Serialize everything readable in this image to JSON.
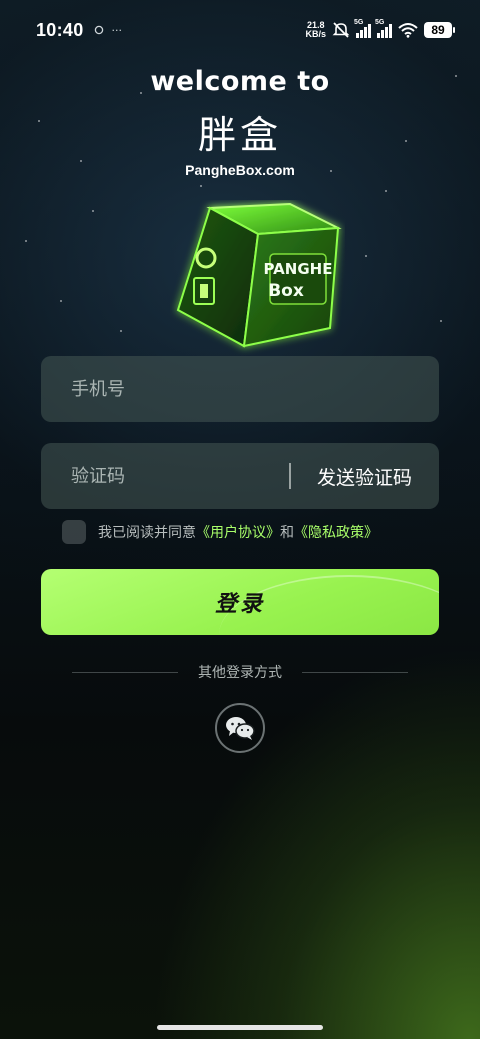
{
  "status_bar": {
    "time": "10:40",
    "notification_icons": [
      "message-icon",
      "more-icon"
    ],
    "net_speed_value": "21.8",
    "net_speed_unit": "KB/s",
    "sim1_label": "5G",
    "sim2_label": "5G",
    "battery": "89"
  },
  "brand": {
    "welcome": "welcome to",
    "logo_text": "胖盒",
    "domain": "PangheBox.com",
    "cube_text_line1": "PANGHE",
    "cube_text_line2": "Box"
  },
  "form": {
    "phone_placeholder": "手机号",
    "code_placeholder": "验证码",
    "send_code_label": "发送验证码",
    "agree_prefix": "我已阅读并同意",
    "user_agreement": "《用户协议》",
    "agree_and": "和",
    "privacy_policy": "《隐私政策》",
    "login_label": "登录",
    "other_login": "其他登录方式"
  },
  "colors": {
    "accent": "#9cf456",
    "link": "#a9ff6a",
    "field_bg": "#3f504d"
  }
}
